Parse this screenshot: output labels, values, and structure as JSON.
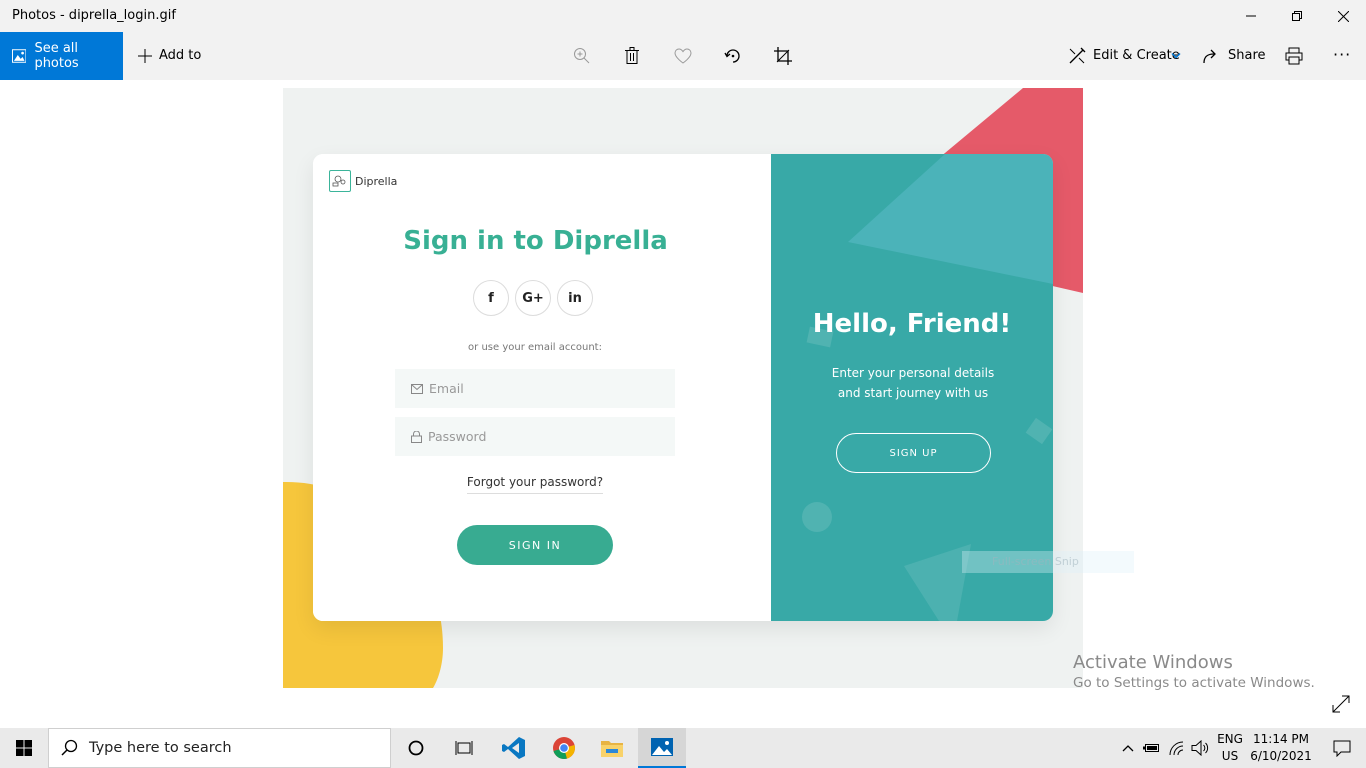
{
  "window": {
    "title": "Photos - diprella_login.gif"
  },
  "toolbar": {
    "see_all_label": "See all photos",
    "add_to_label": "Add to",
    "edit_create_label": "Edit & Create",
    "share_label": "Share",
    "more_label": "···"
  },
  "image": {
    "brand": "Diprella",
    "heading": "Sign in to Diprella",
    "social": [
      "f",
      "G+",
      "in"
    ],
    "or_text": "or use your email account:",
    "email_placeholder": "Email",
    "password_placeholder": "Password",
    "forgot_label": "Forgot your password?",
    "sign_in_label": "SIGN IN",
    "hello_heading": "Hello, Friend!",
    "hello_line1": "Enter your personal details",
    "hello_line2": "and start journey with us",
    "sign_up_label": "SIGN UP",
    "snip_tip": "Full-screen Snip",
    "colors": {
      "accent_green": "#38b094",
      "panel_teal": "#38a9a7",
      "red_shape": "#e55a69",
      "yellow_shape": "#f6c63c"
    }
  },
  "watermark": {
    "line1": "Activate Windows",
    "line2": "Go to Settings to activate Windows."
  },
  "taskbar": {
    "search_placeholder": "Type here to search",
    "lang": "ENG",
    "region": "US",
    "time": "11:14 PM",
    "date": "6/10/2021"
  },
  "accent": "#0078d7"
}
